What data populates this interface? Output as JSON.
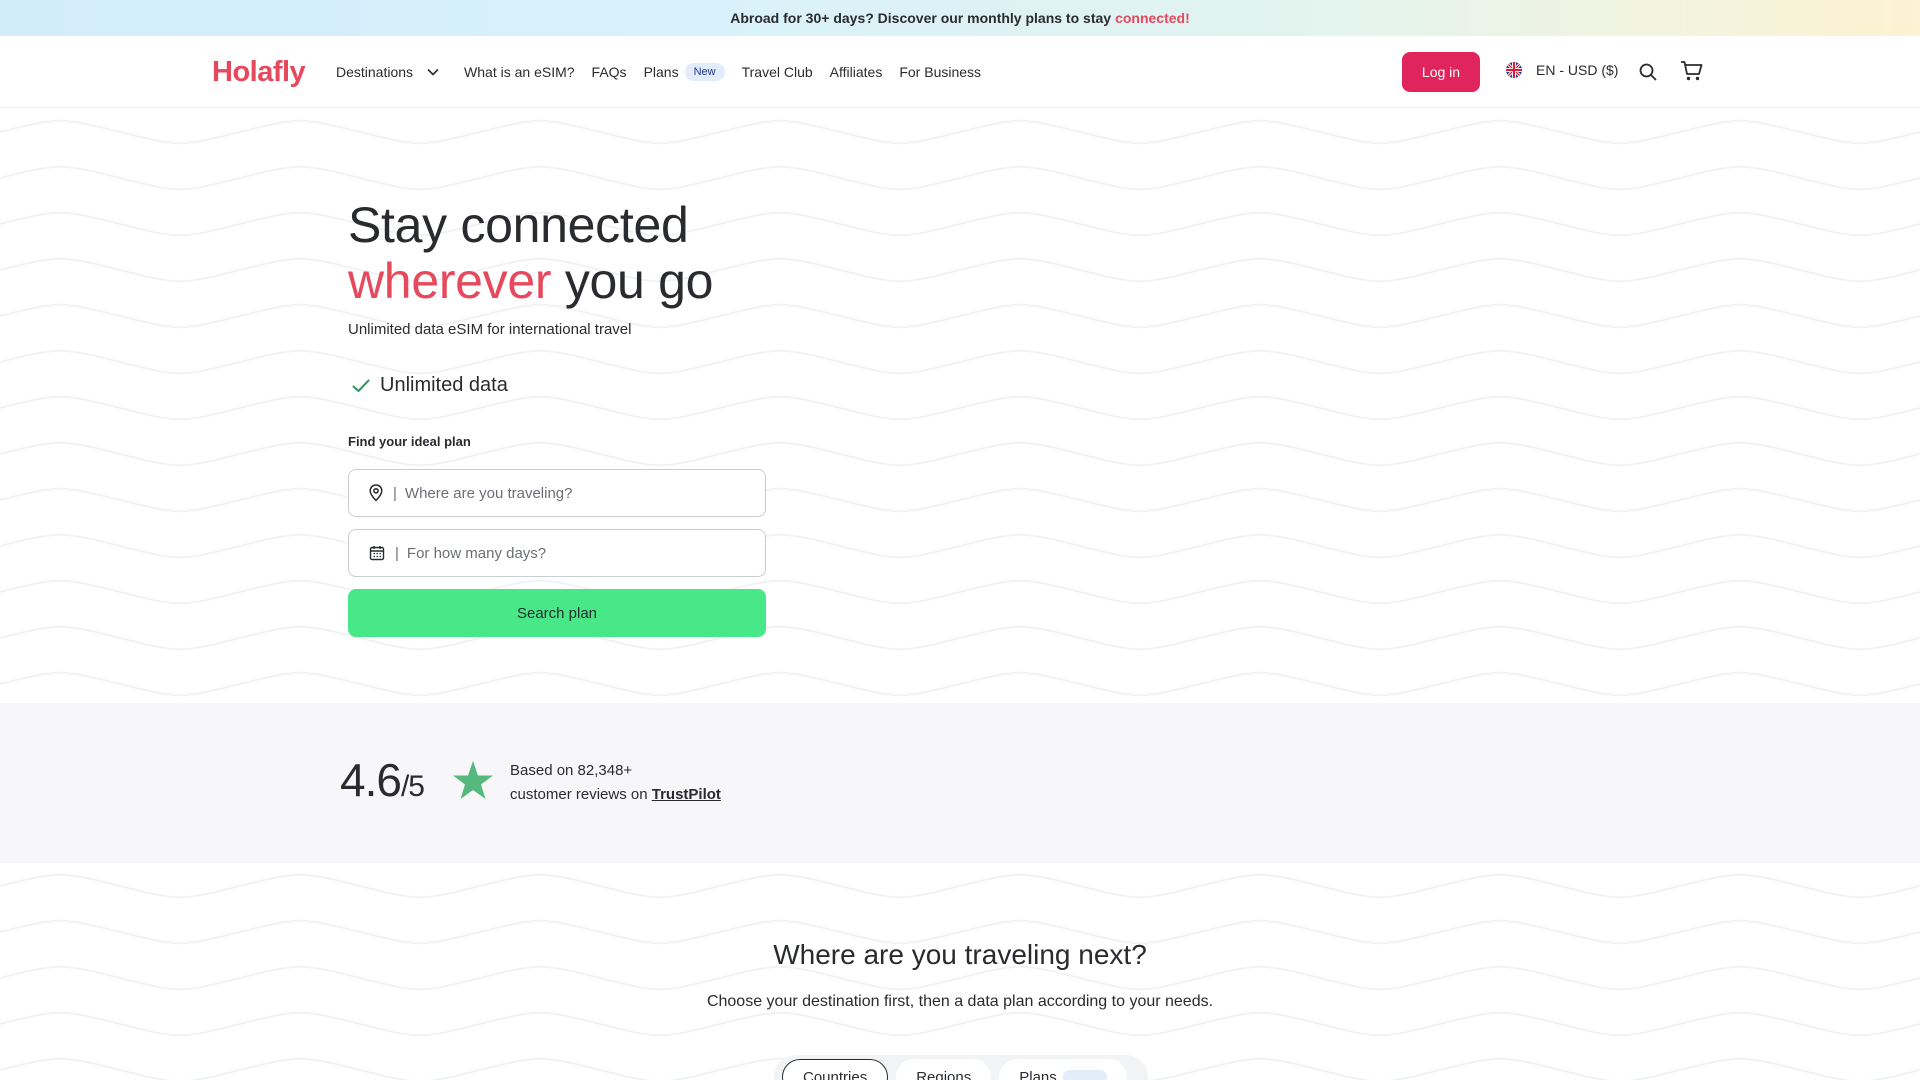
{
  "announcement": {
    "text": "Abroad for 30+ days? Discover our monthly plans to stay",
    "highlight": "connected!"
  },
  "header": {
    "logo": "Holafly",
    "nav": [
      {
        "label": "Destinations"
      },
      {
        "label": "What is an eSIM?"
      },
      {
        "label": "FAQs"
      },
      {
        "label": "Plans",
        "badge": "New"
      },
      {
        "label": "Travel Club"
      },
      {
        "label": "Affiliates"
      },
      {
        "label": "For Business"
      }
    ],
    "login_label": "Log in",
    "locale_label": "EN - USD ($)"
  },
  "hero": {
    "title_line1": "Stay connected",
    "title_highlight": "wherever",
    "title_rest": "you go",
    "subtitle": "Unlimited data eSIM for international travel",
    "feature": "Unlimited data",
    "find_label": "Find your ideal plan",
    "destination_placeholder": "Where are you traveling?",
    "days_placeholder": "For how many days?",
    "field_separator": "|",
    "search_label": "Search plan"
  },
  "rating": {
    "score": "4.6",
    "out_of": "/5",
    "line1": "Based on 82,348+",
    "line2": "customer reviews on",
    "link": "TrustPilot",
    "star_color": "#57b87d"
  },
  "destinations": {
    "title": "Where are you traveling next?",
    "subtitle": "Choose your destination first, then a data plan according to your needs.",
    "tabs": [
      "Countries",
      "Regions",
      "Plans"
    ]
  },
  "colors": {
    "brand": "#e6485c",
    "login": "#e0245e",
    "search": "#48e888"
  }
}
